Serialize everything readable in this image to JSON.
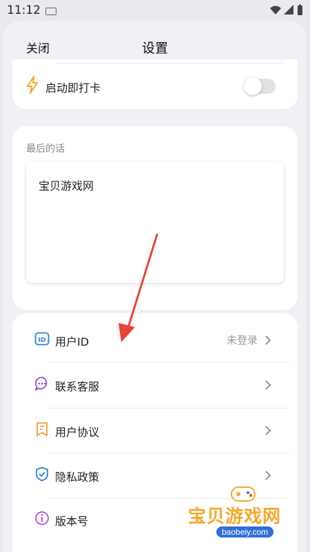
{
  "status_bar": {
    "time": "11:12"
  },
  "header": {
    "close_label": "关闭",
    "title": "设置"
  },
  "auto_checkin": {
    "label": "启动即打卡",
    "enabled": false,
    "icon": "lightning-icon"
  },
  "last_words": {
    "section_label": "最后的话",
    "text": "宝贝游戏网"
  },
  "menu": [
    {
      "id": "user-id",
      "label": "用户ID",
      "value": "未登录",
      "icon": "id-card-icon"
    },
    {
      "id": "contact",
      "label": "联系客服",
      "value": "",
      "icon": "chat-bubble-icon"
    },
    {
      "id": "agreement",
      "label": "用户协议",
      "value": "",
      "icon": "bookmark-doc-icon"
    },
    {
      "id": "privacy",
      "label": "隐私政策",
      "value": "",
      "icon": "shield-check-icon"
    },
    {
      "id": "version",
      "label": "版本号",
      "value": "",
      "icon": "info-icon"
    }
  ],
  "colors": {
    "id": "#2f7be5",
    "chat": "#8b4fd6",
    "agreement": "#f0962a",
    "privacy": "#2f7be5",
    "info": "#b34fd6",
    "lightning": "#f5a623",
    "arrow": "#e8443a"
  },
  "watermark": {
    "text": "宝贝游戏网",
    "url": "baobeiy.com"
  }
}
